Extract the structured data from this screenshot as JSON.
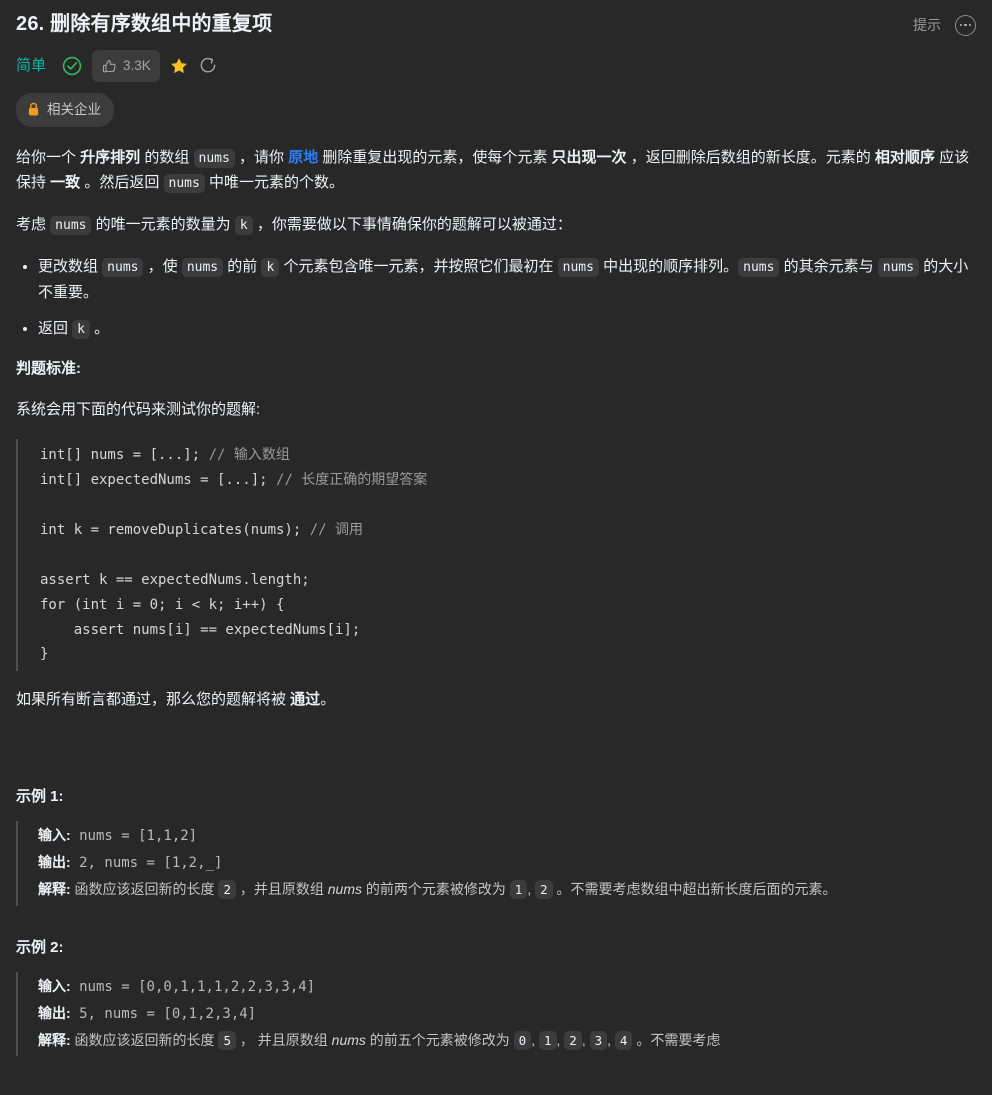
{
  "header": {
    "title": "26. 删除有序数组中的重复项",
    "hint_label": "提示",
    "more_icon": "ellipsis-icon"
  },
  "meta": {
    "difficulty": "简单",
    "difficulty_color": "#00b8a3",
    "solved_icon": "check-circle-icon",
    "vote_count": "3.3K",
    "vote_icon": "thumbs-up-icon",
    "star_icon": "star-icon",
    "star_color": "#ffc01e",
    "share_icon": "share-icon"
  },
  "company_badge": {
    "label": "相关企业",
    "lock_icon": "lock-icon",
    "lock_color": "#ef9c18"
  },
  "description": {
    "p1_a": "给你一个 ",
    "p1_b": "升序排列",
    "p1_c": " 的数组 ",
    "p1_code1": "nums",
    "p1_d": " ，请你 ",
    "p1_link": "原地",
    "p1_e": " 删除重复出现的元素，使每个元素 ",
    "p1_f": "只出现一次",
    "p1_g": " ，返回删除后数组的新长度。元素的 ",
    "p1_h": "相对顺序",
    "p1_i": " 应该保持 ",
    "p1_j": "一致",
    "p1_k": " 。然后返回 ",
    "p1_code2": "nums",
    "p1_l": " 中唯一元素的个数。",
    "p2_a": "考虑 ",
    "p2_code1": "nums",
    "p2_b": " 的唯一元素的数量为 ",
    "p2_code2": "k",
    "p2_c": " ，你需要做以下事情确保你的题解可以被通过：",
    "bullet1_a": "更改数组 ",
    "bullet1_code1": "nums",
    "bullet1_b": " ，使 ",
    "bullet1_code2": "nums",
    "bullet1_c": " 的前 ",
    "bullet1_code3": "k",
    "bullet1_d": " 个元素包含唯一元素，并按照它们最初在 ",
    "bullet1_code4": "nums",
    "bullet1_e": " 中出现的顺序排列。",
    "bullet1_code5": "nums",
    "bullet1_f": " 的其余元素与 ",
    "bullet1_code6": "nums",
    "bullet1_g": " 的大小不重要。",
    "bullet2_a": "返回 ",
    "bullet2_code1": "k",
    "bullet2_b": " 。",
    "judge_heading": "判题标准:",
    "judge_intro": "系统会用下面的代码来测试你的题解:",
    "outro_a": "如果所有断言都通过，那么您的题解将被 ",
    "outro_b": "通过",
    "outro_c": "。"
  },
  "code_block": {
    "line1_code": "int[] nums = [...]; ",
    "line1_comment": "// 输入数组",
    "line2_code": "int[] expectedNums = [...]; ",
    "line2_comment": "// 长度正确的期望答案",
    "line3_blank": "",
    "line4_code": "int k = removeDuplicates(nums); ",
    "line4_comment": "// 调用",
    "line5_blank": "",
    "line6_code": "assert k == expectedNums.length;",
    "line7_code": "for (int i = 0; i < k; i++) {",
    "line8_code": "    assert nums[i] == expectedNums[i];",
    "line9_code": "}"
  },
  "examples": [
    {
      "heading": "示例 1:",
      "input_label": "输入:",
      "input_value": " nums = [1,1,2]",
      "output_label": "输出:",
      "output_value": " 2, nums = [1,2,_]",
      "explain_label": "解释:",
      "explain_a": " 函数应该返回新的长度 ",
      "explain_code1": "2",
      "explain_b": " ，并且原数组 ",
      "explain_em": "nums",
      "explain_c": " 的前两个元素被修改为 ",
      "explain_code2": "1",
      "explain_d": ", ",
      "explain_code3": "2",
      "explain_e": " 。不需要考虑数组中超出新长度后面的元素。"
    },
    {
      "heading": "示例 2:",
      "input_label": "输入:",
      "input_value": " nums = [0,0,1,1,1,2,2,3,3,4]",
      "output_label": "输出:",
      "output_value": " 5, nums = [0,1,2,3,4]",
      "explain_label": "解释:",
      "explain_a": " 函数应该返回新的长度 ",
      "explain_code1": "5",
      "explain_b": " ， 并且原数组 ",
      "explain_em": "nums",
      "explain_c": " 的前五个元素被修改为 ",
      "explain_code2": "0",
      "explain_d": ", ",
      "explain_code3": "1",
      "explain_e": ", ",
      "explain_code4": "2",
      "explain_f": ", ",
      "explain_code5": "3",
      "explain_g": ", ",
      "explain_code6": "4",
      "explain_h": " 。不需要考虑"
    }
  ]
}
